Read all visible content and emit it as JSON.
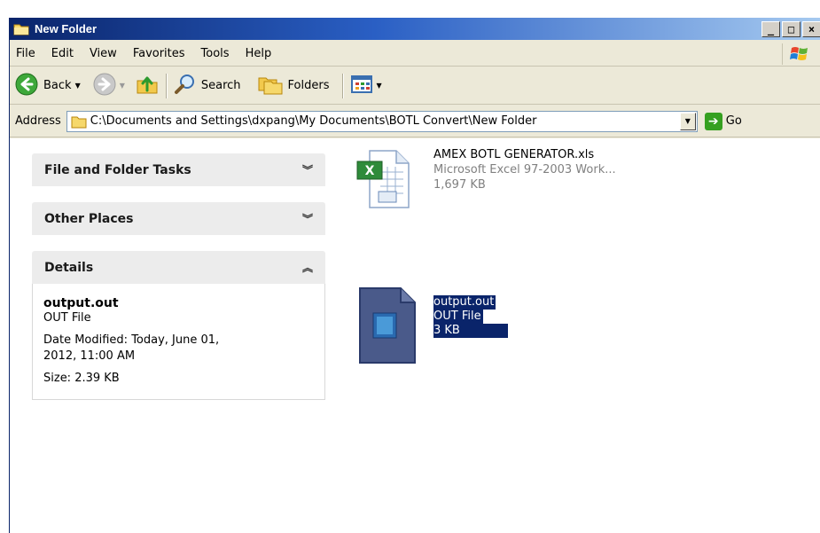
{
  "window": {
    "title": "New Folder",
    "buttons": [
      "_",
      "□",
      "×"
    ]
  },
  "menu": [
    "File",
    "Edit",
    "View",
    "Favorites",
    "Tools",
    "Help"
  ],
  "toolbar": {
    "back": "Back",
    "search": "Search",
    "folders": "Folders"
  },
  "address": {
    "label": "Address",
    "path": "C:\\Documents and Settings\\dxpang\\My Documents\\BOTL Convert\\New Folder",
    "go": "Go"
  },
  "panels": {
    "file_tasks": "File and Folder Tasks",
    "other_places": "Other Places",
    "details": "Details"
  },
  "details": {
    "name": "output.out",
    "type": "OUT File",
    "modified_1": "Date Modified: Today, June 01,",
    "modified_2": "2012, 11:00 AM",
    "size": "Size: 2.39 KB"
  },
  "files": [
    {
      "name": "AMEX BOTL GENERATOR.xls",
      "type": "Microsoft Excel 97-2003 Work...",
      "size": "1,697 KB"
    },
    {
      "name": "output.out",
      "type": "OUT File",
      "size": "3 KB"
    }
  ],
  "colors": {
    "title_start": "#0a246a",
    "selection": "#0a246a",
    "window_bg": "#ece9d8"
  }
}
